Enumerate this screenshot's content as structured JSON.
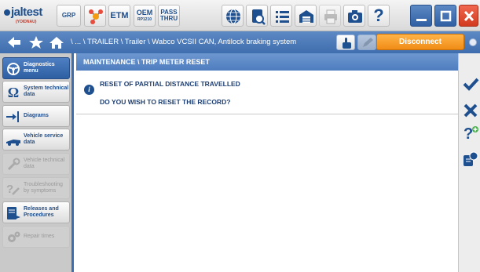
{
  "app": {
    "logo_text": "jaltest",
    "logo_sub": "(YOIDNAU)"
  },
  "toolbar": {
    "grp_label": "GRP",
    "etm_label": "ETM",
    "oem_label": "OEM",
    "oem_sub": "RP1210",
    "pass_label": "PASS",
    "thru_label": "THRU",
    "help_label": "?"
  },
  "breadcrumb": {
    "path": "\\ ... \\ TRAILER \\ Trailer \\ Wabco VCSII CAN, Antilock braking system",
    "disconnect_label": "Disconnect"
  },
  "sidebar": {
    "items": [
      {
        "label": "Diagnostics menu",
        "icon": "steering-wheel-icon",
        "state": "active"
      },
      {
        "label": "System technical data",
        "icon": "omega-icon",
        "state": "normal"
      },
      {
        "label": "Diagrams",
        "icon": "diagram-icon",
        "state": "normal"
      },
      {
        "label": "Vehicle service data",
        "icon": "vehicle-service-icon",
        "state": "normal"
      },
      {
        "label": "Vehicle technical data",
        "icon": "wrench-icon",
        "state": "disabled"
      },
      {
        "label": "Troubleshooting by symptoms",
        "icon": "troubleshoot-icon",
        "state": "disabled"
      },
      {
        "label": "Releases and Procedures",
        "icon": "releases-icon",
        "state": "normal"
      },
      {
        "label": "Repair times",
        "icon": "gears-icon",
        "state": "disabled"
      }
    ]
  },
  "main": {
    "header": "MAINTENANCE \\ TRIP METER RESET",
    "message_title": "RESET OF PARTIAL DISTANCE TRAVELLED",
    "message_question": "DO YOU WISH TO RESET THE RECORD?",
    "info_glyph": "i"
  },
  "actions": {
    "confirm_icon": "checkmark-icon",
    "cancel_icon": "x-icon",
    "help_icon": "help-plus-icon",
    "info_icon": "info-settings-icon",
    "help_glyph": "?"
  },
  "colors": {
    "accent_blue": "#3f6eae",
    "disconnect_orange": "#f08c16",
    "close_red": "#e0452b",
    "text_blue": "#1e3f73"
  }
}
